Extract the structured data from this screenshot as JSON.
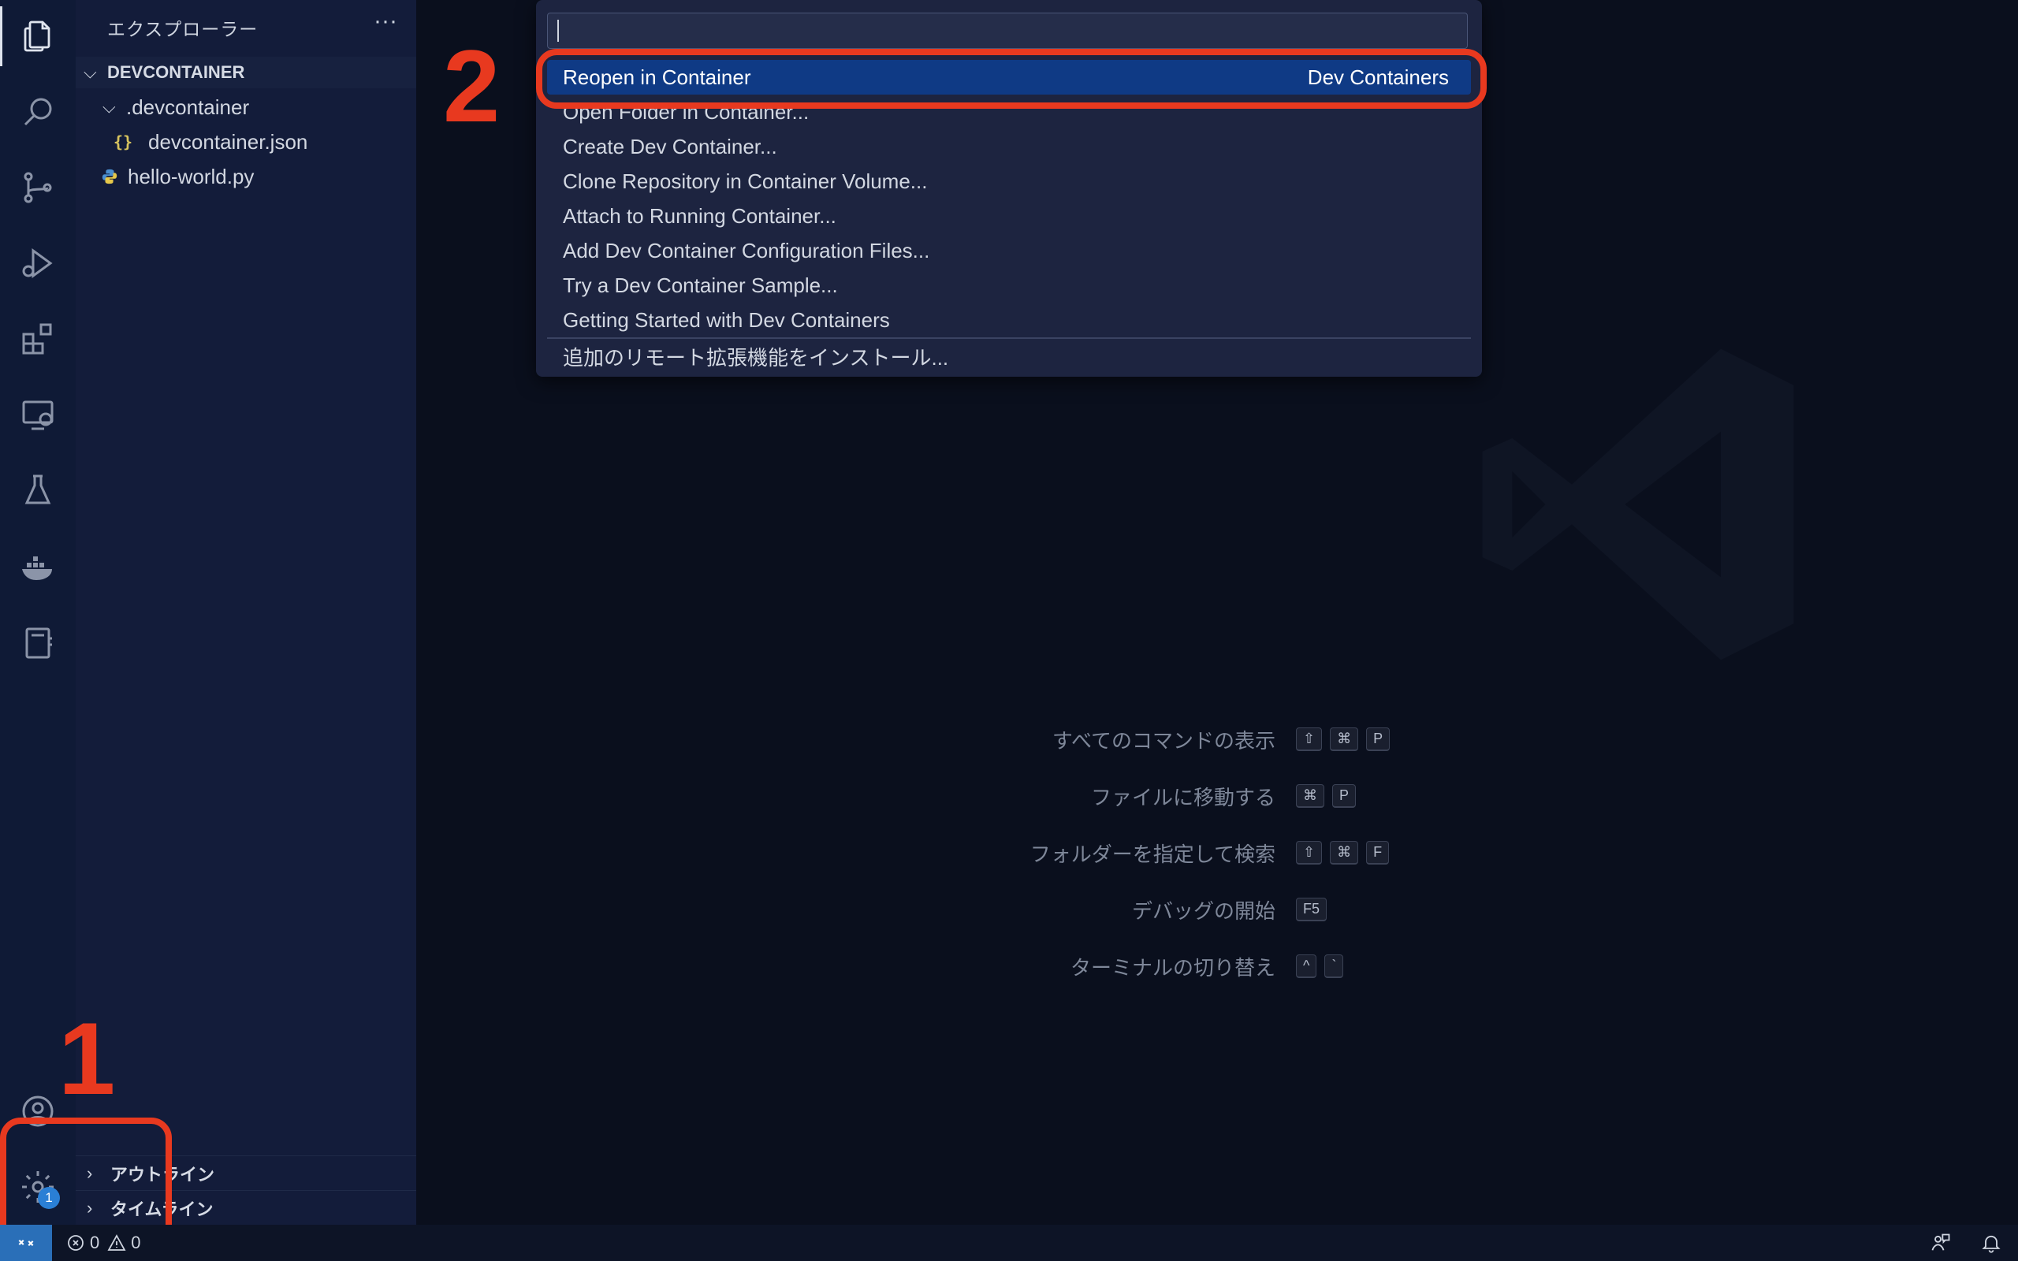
{
  "sidebar": {
    "header": "エクスプローラー",
    "more": "···",
    "section_title": "DEVCONTAINER",
    "tree": [
      {
        "label": ".devcontainer",
        "type": "folder"
      },
      {
        "label": "devcontainer.json",
        "type": "json"
      },
      {
        "label": "hello-world.py",
        "type": "python"
      }
    ],
    "bottom_sections": [
      "アウトライン",
      "タイムライン"
    ]
  },
  "activity_bar": {
    "icons": [
      "explorer-icon",
      "search-icon",
      "source-control-icon",
      "run-debug-icon",
      "extensions-icon",
      "remote-explorer-icon",
      "testing-icon",
      "docker-icon",
      "notebook-icon",
      "account-icon",
      "settings-gear-icon"
    ],
    "settings_badge": "1"
  },
  "quick_pick": {
    "input_value": "",
    "items": [
      {
        "label": "Reopen in Container",
        "detail": "Dev Containers",
        "selected": true
      },
      {
        "label": "Open Folder in Container..."
      },
      {
        "label": "Create Dev Container..."
      },
      {
        "label": "Clone Repository in Container Volume..."
      },
      {
        "label": "Attach to Running Container..."
      },
      {
        "label": "Add Dev Container Configuration Files..."
      },
      {
        "label": "Try a Dev Container Sample..."
      },
      {
        "label": "Getting Started with Dev Containers"
      },
      {
        "label": "追加のリモート拡張機能をインストール..."
      }
    ]
  },
  "shortcuts": [
    {
      "label": "すべてのコマンドの表示",
      "keys": [
        "⇧",
        "⌘",
        "P"
      ]
    },
    {
      "label": "ファイルに移動する",
      "keys": [
        "⌘",
        "P"
      ]
    },
    {
      "label": "フォルダーを指定して検索",
      "keys": [
        "⇧",
        "⌘",
        "F"
      ]
    },
    {
      "label": "デバッグの開始",
      "keys": [
        "F5"
      ]
    },
    {
      "label": "ターミナルの切り替え",
      "keys": [
        "^",
        "`"
      ]
    }
  ],
  "annotations": {
    "one": "1",
    "two": "2"
  },
  "status_bar": {
    "errors": "0",
    "warnings": "0"
  },
  "colors": {
    "accent": "#e8391f",
    "selection": "#0f3a85",
    "remote": "#2a6fb8"
  }
}
